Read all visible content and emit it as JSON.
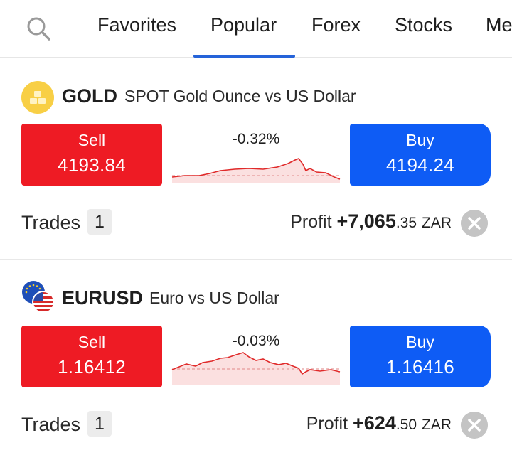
{
  "tabs": [
    {
      "label": "Favorites",
      "active": false
    },
    {
      "label": "Popular",
      "active": true
    },
    {
      "label": "Forex",
      "active": false
    },
    {
      "label": "Stocks",
      "active": false
    },
    {
      "label": "Me",
      "active": false
    }
  ],
  "search_icon": "search-icon",
  "colors": {
    "sell": "#ee1b24",
    "buy": "#0e5cf5",
    "active_tab": "#2563d9",
    "sparkline": "#e02a2a"
  },
  "instruments": [
    {
      "symbol": "GOLD",
      "description": "SPOT Gold Ounce vs US Dollar",
      "icon": "gold-bars-icon",
      "sell_label": "Sell",
      "sell_price": "4193.84",
      "buy_label": "Buy",
      "buy_price": "4194.24",
      "change": "-0.32%",
      "trades_label": "Trades",
      "trades_count": "1",
      "profit_label": "Profit",
      "profit_main": "+7,065",
      "profit_decimals": ".35",
      "profit_currency": "ZAR"
    },
    {
      "symbol": "EURUSD",
      "description": "Euro vs US Dollar",
      "icon": "eu-us-flags-icon",
      "sell_label": "Sell",
      "sell_price": "1.16412",
      "buy_label": "Buy",
      "buy_price": "1.16416",
      "change": "-0.03%",
      "trades_label": "Trades",
      "trades_count": "1",
      "profit_label": "Profit",
      "profit_main": "+624",
      "profit_decimals": ".50",
      "profit_currency": "ZAR"
    }
  ]
}
